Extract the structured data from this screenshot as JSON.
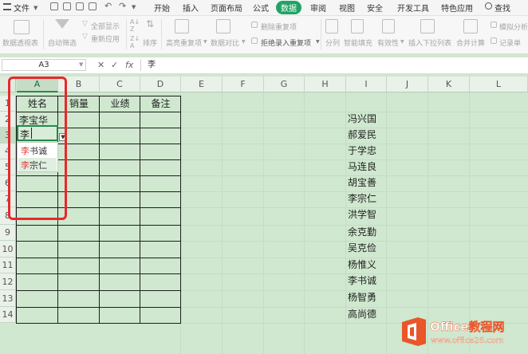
{
  "menu": {
    "file": "文件",
    "tabs": [
      "开始",
      "插入",
      "页面布局",
      "公式",
      "数据",
      "审阅",
      "视图",
      "安全",
      "开发工具",
      "特色应用"
    ],
    "active_tab": "数据",
    "search": "查找"
  },
  "ribbon": {
    "pivot": "数据透视表",
    "autofilter": "自动筛选",
    "show_all": "全部显示",
    "reapply": "重新应用",
    "sort": "排序",
    "highlight_dup": "高亮重复项",
    "compare": "数据对比",
    "remove_dup": "删除重复项",
    "reject_dup": "拒绝录入重复项",
    "split": "分列",
    "smart_fill": "智能填充",
    "validity": "有效性",
    "insert_dropdown": "插入下拉列表",
    "consolidate": "合并计算",
    "whatif": "模拟分析",
    "record": "记录单"
  },
  "formula_bar": {
    "name_box": "A3",
    "fx": "fx",
    "value": "李"
  },
  "columns": [
    "A",
    "B",
    "C",
    "D",
    "E",
    "F",
    "G",
    "H",
    "I",
    "J",
    "K",
    "L"
  ],
  "selected_column": "A",
  "rows": [
    "1",
    "2",
    "3",
    "4",
    "5",
    "6",
    "7",
    "8",
    "9",
    "10",
    "11",
    "12",
    "13",
    "14"
  ],
  "selected_row": "3",
  "table": {
    "headers": [
      "姓名",
      "销量",
      "业绩",
      "备注"
    ],
    "a2": "李宝华",
    "a3": "李"
  },
  "autocomplete": {
    "items": [
      {
        "hl": "李",
        "rest": "书诚"
      },
      {
        "hl": "李",
        "rest": "宗仁"
      }
    ]
  },
  "name_list": [
    "冯兴国",
    "郝爱民",
    "于学忠",
    "马连良",
    "胡宝善",
    "李宗仁",
    "洪学智",
    "余克勤",
    "吴克俭",
    "杨惟义",
    "李书诚",
    "杨智勇",
    "高尚德"
  ],
  "watermark": {
    "text": "Office教程网",
    "url": "www.office26.com"
  },
  "colors": {
    "accent": "#21a366",
    "sheet_bg": "#cfe8cf",
    "red_box": "#e8282d",
    "logo_orange": "#e8562a"
  }
}
